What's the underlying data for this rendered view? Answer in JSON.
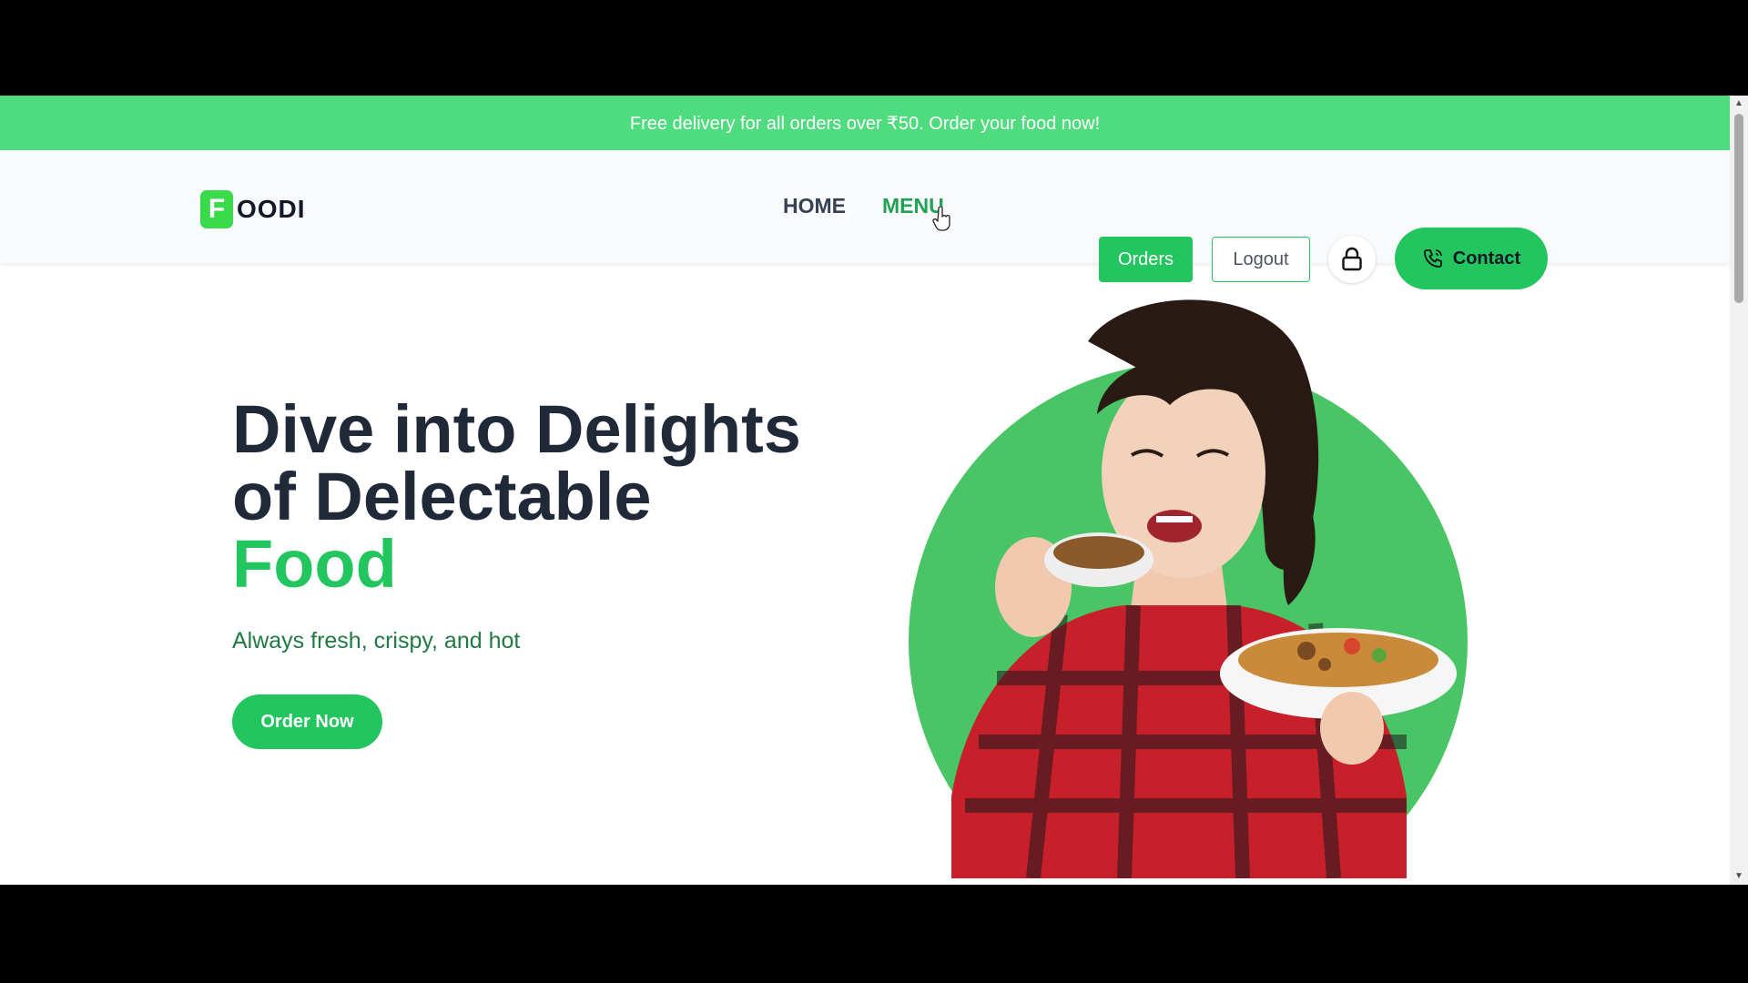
{
  "promo": {
    "text": "Free delivery for all orders over ₹50. Order your food now!"
  },
  "brand": {
    "badge": "F",
    "rest": "OODI"
  },
  "nav": {
    "items": [
      {
        "label": "HOME"
      },
      {
        "label": "MENU"
      }
    ]
  },
  "actions": {
    "orders": "Orders",
    "logout": "Logout",
    "contact": "Contact"
  },
  "icons": {
    "lock": "lock-icon",
    "phone": "phone-icon",
    "cursor": "hand-cursor-icon"
  },
  "hero": {
    "title_line1": "Dive into Delights",
    "title_line2": "of Delectable",
    "title_accent": "Food",
    "subtitle": "Always fresh, crispy, and hot",
    "cta": "Order Now"
  },
  "colors": {
    "accent": "#22c55e",
    "promo_bg": "#4fdc7f",
    "heading": "#1f2937"
  }
}
